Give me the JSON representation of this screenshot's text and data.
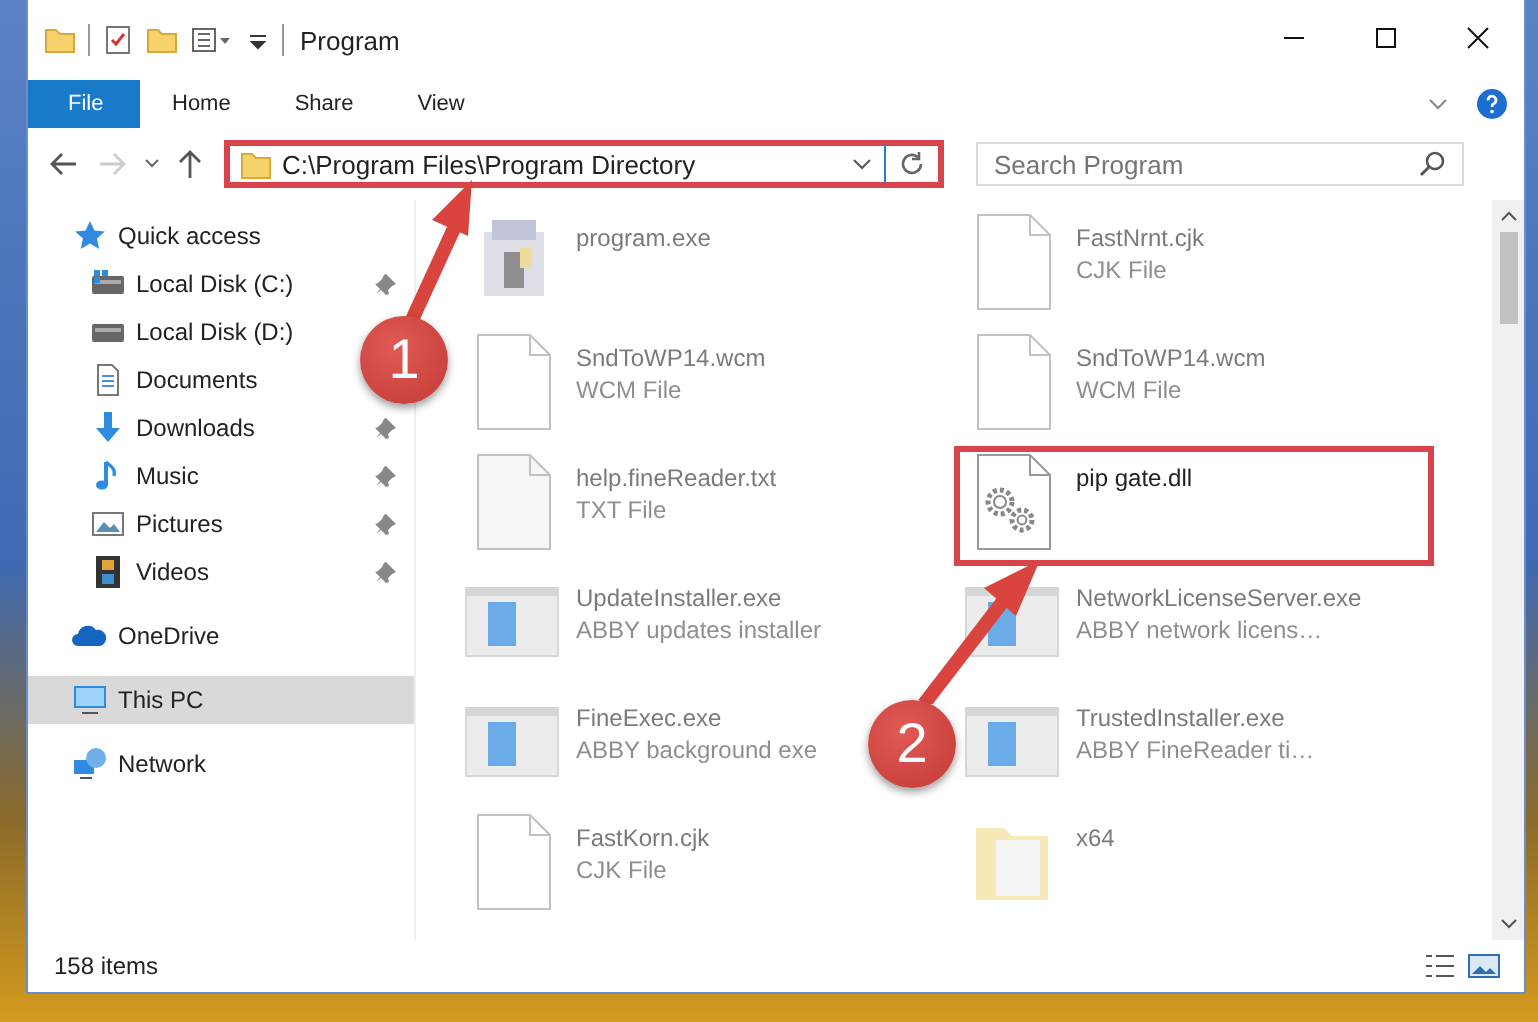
{
  "window": {
    "title": "Program"
  },
  "ribbon_tabs": [
    {
      "label": "File",
      "kind": "file-menu"
    },
    {
      "label": "Home",
      "kind": "tab"
    },
    {
      "label": "Share",
      "kind": "tab"
    },
    {
      "label": "View",
      "kind": "tab"
    }
  ],
  "address_bar": {
    "path": "C:\\Program Files\\Program Directory",
    "highlighted": true
  },
  "search": {
    "placeholder": "Search Program"
  },
  "sidebar": {
    "items": [
      {
        "label": "Quick access",
        "kind": "quick-access",
        "selected": false,
        "children": [
          {
            "label": "Local Disk (C:)",
            "kind": "system-drive",
            "pinned": true
          },
          {
            "label": "Local Disk (D:)",
            "kind": "drive",
            "pinned": false
          },
          {
            "label": "Documents",
            "kind": "documents",
            "pinned": false
          },
          {
            "label": "Downloads",
            "kind": "downloads",
            "pinned": true
          },
          {
            "label": "Music",
            "kind": "music",
            "pinned": true
          },
          {
            "label": "Pictures",
            "kind": "pictures",
            "pinned": true
          },
          {
            "label": "Videos",
            "kind": "videos",
            "pinned": true
          }
        ]
      },
      {
        "label": "OneDrive",
        "kind": "cloud",
        "selected": false
      },
      {
        "label": "This PC",
        "kind": "computer",
        "selected": true
      },
      {
        "label": "Network",
        "kind": "network",
        "selected": false
      }
    ]
  },
  "files": [
    {
      "name": "program.exe",
      "kind": "app",
      "selected": false
    },
    {
      "name": "FastNrnt.cjk",
      "type": "CJK File",
      "kind": "blank",
      "selected": false
    },
    {
      "name": "SndToWP14.wcm",
      "type": "WCM File",
      "kind": "blank",
      "selected": false
    },
    {
      "name": "SndToWP14.wcm",
      "type": "WCM File",
      "kind": "blank",
      "selected": false
    },
    {
      "name": "help.fineReader.txt",
      "type": "TXT File",
      "kind": "text",
      "selected": false
    },
    {
      "name": "pip gate.dll",
      "kind": "gear",
      "selected": true
    },
    {
      "name": "UpdateInstaller.exe",
      "type": "ABBY updates installer",
      "kind": "window",
      "selected": false
    },
    {
      "name": "NetworkLicenseServer.exe",
      "type": "ABBY network licens…",
      "kind": "window",
      "selected": false
    },
    {
      "name": "FineExec.exe",
      "type": "ABBY background exe",
      "kind": "window",
      "selected": false
    },
    {
      "name": "TrustedInstaller.exe",
      "type": "ABBY FineReader ti…",
      "kind": "window",
      "selected": false
    },
    {
      "name": "FastKorn.cjk",
      "type": "CJK File",
      "kind": "blank",
      "selected": false
    },
    {
      "name": "x64",
      "kind": "folder",
      "selected": false
    }
  ],
  "callouts": [
    {
      "number": "1"
    },
    {
      "number": "2"
    }
  ],
  "status_bar": {
    "count": "158 items"
  }
}
